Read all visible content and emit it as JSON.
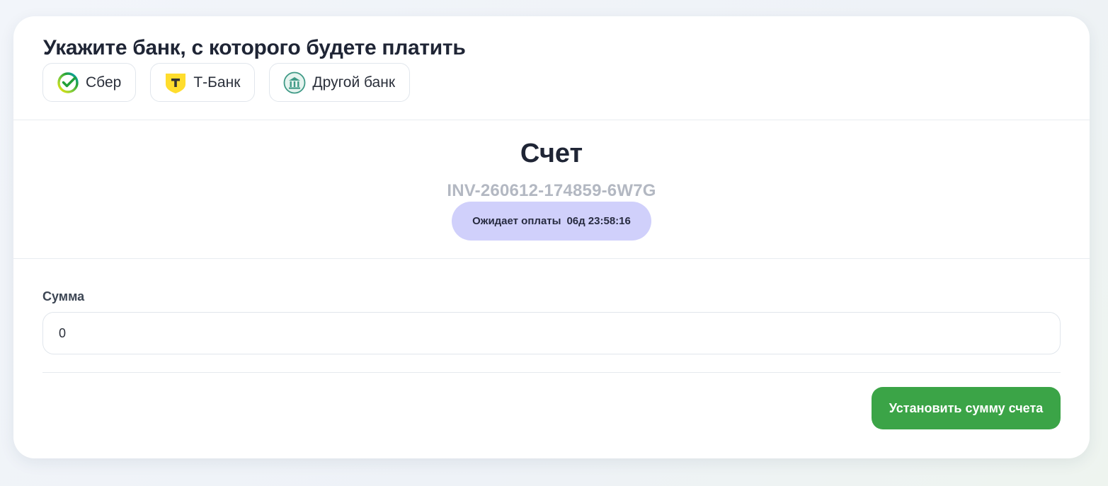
{
  "bank_section": {
    "title": "Укажите банк, с которого будете платить",
    "banks": [
      {
        "label": "Сбер",
        "icon": "sber-logo-icon"
      },
      {
        "label": "Т-Банк",
        "icon": "tbank-logo-icon"
      },
      {
        "label": "Другой банк",
        "icon": "bank-building-icon"
      }
    ]
  },
  "invoice": {
    "title": "Счет",
    "id": "INV-260612-174859-6W7G",
    "status_label": "Ожидает оплаты",
    "timer": "06д 23:58:16"
  },
  "amount": {
    "label": "Сумма",
    "value": "0"
  },
  "actions": {
    "submit_label": "Установить сумму счета"
  },
  "colors": {
    "accent_green": "#3ba447",
    "status_bg": "#d0d0fb",
    "tbank_yellow": "#ffdd2d"
  }
}
